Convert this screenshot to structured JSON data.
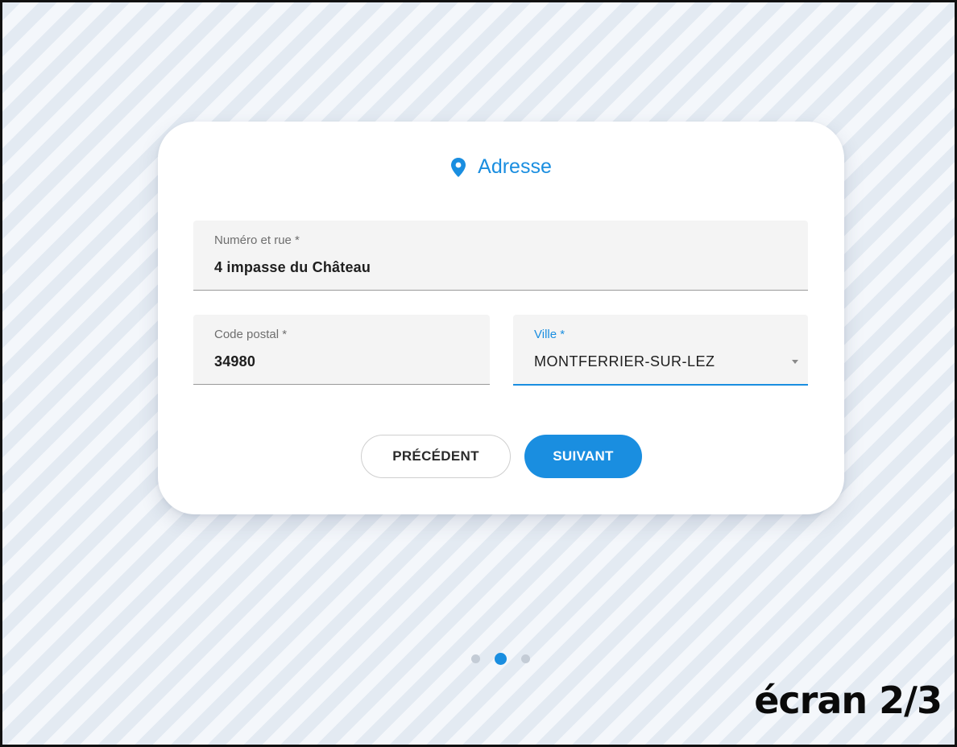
{
  "card": {
    "title": "Adresse",
    "icon": "map-pin-icon",
    "accent_color": "#1a8ee0"
  },
  "fields": {
    "street": {
      "label": "Numéro et rue *",
      "value": "4 impasse du Château"
    },
    "postal_code": {
      "label": "Code postal *",
      "value": "34980"
    },
    "city": {
      "label": "Ville *",
      "value": "MONTFERRIER-SUR-LEZ"
    }
  },
  "buttons": {
    "previous": "PRÉCÉDENT",
    "next": "SUIVANT"
  },
  "pager": {
    "total": 3,
    "current": 2
  },
  "screen_counter": "écran 2/3"
}
